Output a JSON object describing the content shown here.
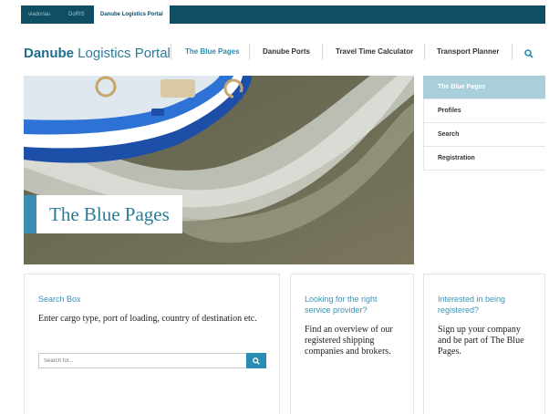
{
  "topbar": {
    "tabs": [
      {
        "label": "viadonau"
      },
      {
        "label": "DoRIS"
      },
      {
        "label": "Danube Logistics Portal"
      }
    ]
  },
  "header": {
    "logo_bold": "Danube",
    "logo_rest": " Logistics Portal",
    "nav": [
      {
        "label": "The Blue Pages"
      },
      {
        "label": "Danube Ports"
      },
      {
        "label": "Travel Time Calculator"
      },
      {
        "label": "Transport Planner"
      }
    ],
    "search_icon": "search-icon"
  },
  "hero": {
    "title": "The Blue Pages"
  },
  "sidemenu": {
    "items": [
      {
        "label": "The Blue Pages"
      },
      {
        "label": "Profiles"
      },
      {
        "label": "Search"
      },
      {
        "label": "Registration"
      }
    ]
  },
  "cards": {
    "search": {
      "title": "Search Box",
      "text": "Enter cargo type, port of loading, country of destination etc.",
      "placeholder": "Search for..."
    },
    "provider": {
      "title": "Looking for the right service provider?",
      "text": "Find an overview of our registered shipping companies and brokers."
    },
    "register": {
      "title": "Interested in being registered?",
      "text": "Sign up your company and be part of The Blue Pages."
    }
  },
  "colors": {
    "topbar": "#0f4e63",
    "accent": "#2b8cb0",
    "menu_active": "#a9cfdb"
  }
}
